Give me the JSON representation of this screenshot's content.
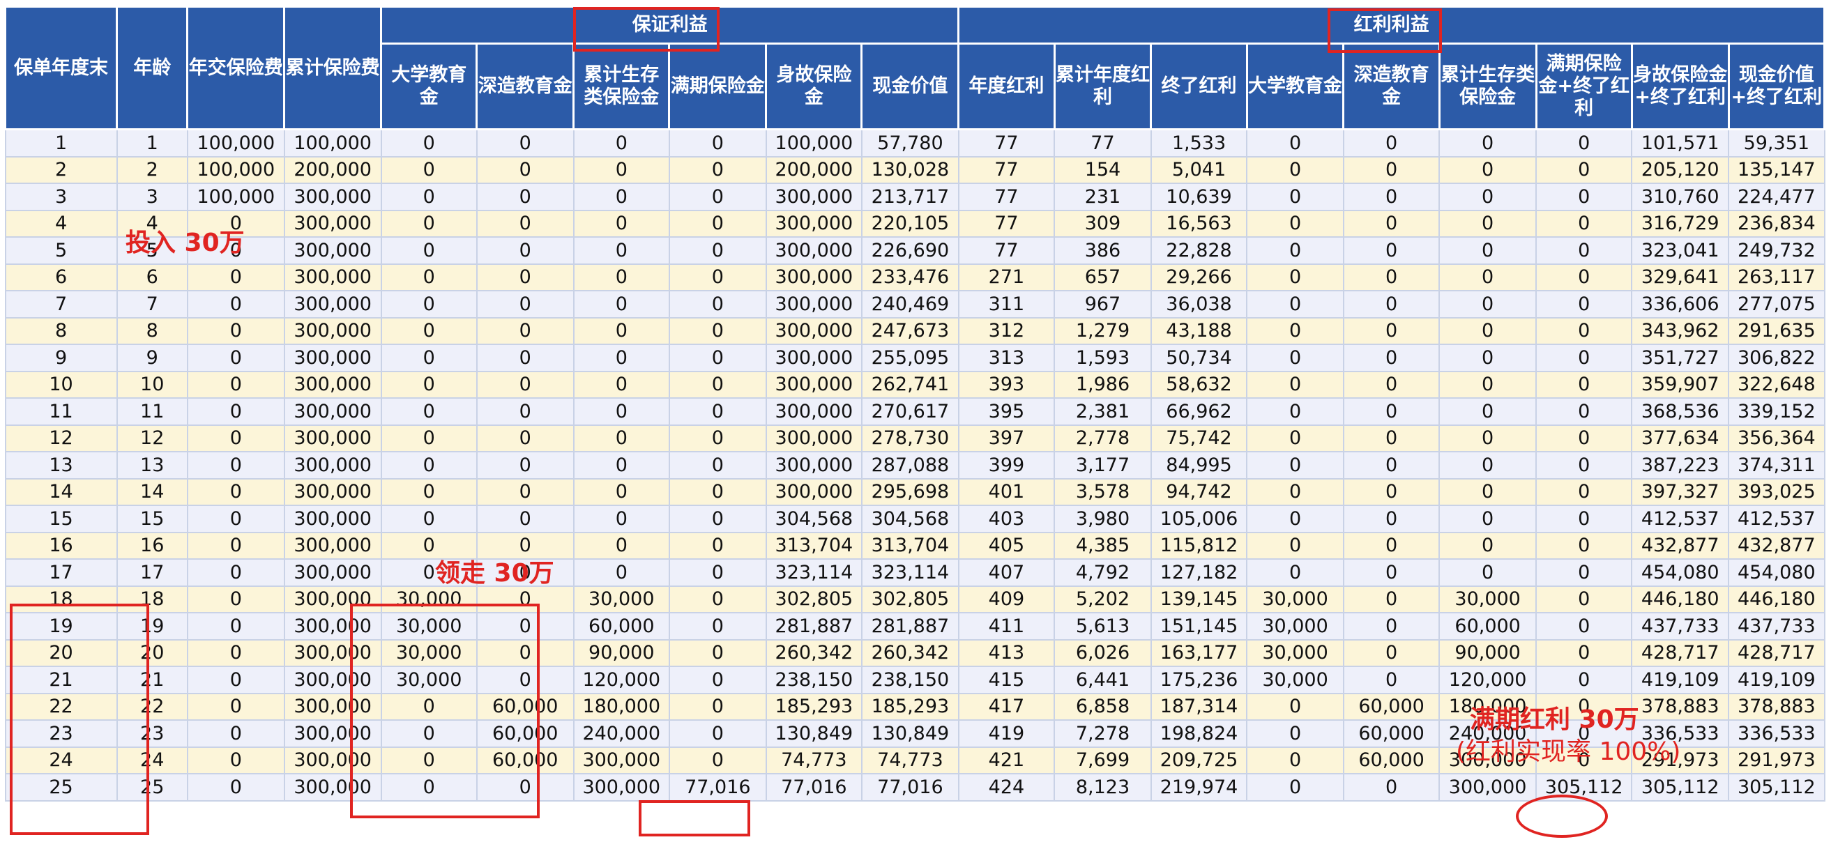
{
  "header": {
    "year_end": "保单年度末",
    "age": "年龄",
    "annual_premium": "年交保险费",
    "cumulative_premium": "累计保险费",
    "guaranteed_group": "保证利益",
    "dividend_group": "红利利益",
    "sub_columns": [
      "大学教育金",
      "深造教育金",
      "累计生存类保险金",
      "满期保险金",
      "身故保险金",
      "现金价值",
      "年度红利",
      "累计年度红利",
      "终了红利",
      "大学教育金",
      "深造教育金",
      "累计生存类保险金",
      "满期保险金+终了红利",
      "身故保险金+终了红利",
      "现金价值+终了红利"
    ]
  },
  "rows": [
    [
      "1",
      "1",
      "100,000",
      "100,000",
      "0",
      "0",
      "0",
      "0",
      "100,000",
      "57,780",
      "77",
      "77",
      "1,533",
      "0",
      "0",
      "0",
      "0",
      "101,571",
      "59,351"
    ],
    [
      "2",
      "2",
      "100,000",
      "200,000",
      "0",
      "0",
      "0",
      "0",
      "200,000",
      "130,028",
      "77",
      "154",
      "5,041",
      "0",
      "0",
      "0",
      "0",
      "205,120",
      "135,147"
    ],
    [
      "3",
      "3",
      "100,000",
      "300,000",
      "0",
      "0",
      "0",
      "0",
      "300,000",
      "213,717",
      "77",
      "231",
      "10,639",
      "0",
      "0",
      "0",
      "0",
      "310,760",
      "224,477"
    ],
    [
      "4",
      "4",
      "0",
      "300,000",
      "0",
      "0",
      "0",
      "0",
      "300,000",
      "220,105",
      "77",
      "309",
      "16,563",
      "0",
      "0",
      "0",
      "0",
      "316,729",
      "236,834"
    ],
    [
      "5",
      "5",
      "0",
      "300,000",
      "0",
      "0",
      "0",
      "0",
      "300,000",
      "226,690",
      "77",
      "386",
      "22,828",
      "0",
      "0",
      "0",
      "0",
      "323,041",
      "249,732"
    ],
    [
      "6",
      "6",
      "0",
      "300,000",
      "0",
      "0",
      "0",
      "0",
      "300,000",
      "233,476",
      "271",
      "657",
      "29,266",
      "0",
      "0",
      "0",
      "0",
      "329,641",
      "263,117"
    ],
    [
      "7",
      "7",
      "0",
      "300,000",
      "0",
      "0",
      "0",
      "0",
      "300,000",
      "240,469",
      "311",
      "967",
      "36,038",
      "0",
      "0",
      "0",
      "0",
      "336,606",
      "277,075"
    ],
    [
      "8",
      "8",
      "0",
      "300,000",
      "0",
      "0",
      "0",
      "0",
      "300,000",
      "247,673",
      "312",
      "1,279",
      "43,188",
      "0",
      "0",
      "0",
      "0",
      "343,962",
      "291,635"
    ],
    [
      "9",
      "9",
      "0",
      "300,000",
      "0",
      "0",
      "0",
      "0",
      "300,000",
      "255,095",
      "313",
      "1,593",
      "50,734",
      "0",
      "0",
      "0",
      "0",
      "351,727",
      "306,822"
    ],
    [
      "10",
      "10",
      "0",
      "300,000",
      "0",
      "0",
      "0",
      "0",
      "300,000",
      "262,741",
      "393",
      "1,986",
      "58,632",
      "0",
      "0",
      "0",
      "0",
      "359,907",
      "322,648"
    ],
    [
      "11",
      "11",
      "0",
      "300,000",
      "0",
      "0",
      "0",
      "0",
      "300,000",
      "270,617",
      "395",
      "2,381",
      "66,962",
      "0",
      "0",
      "0",
      "0",
      "368,536",
      "339,152"
    ],
    [
      "12",
      "12",
      "0",
      "300,000",
      "0",
      "0",
      "0",
      "0",
      "300,000",
      "278,730",
      "397",
      "2,778",
      "75,742",
      "0",
      "0",
      "0",
      "0",
      "377,634",
      "356,364"
    ],
    [
      "13",
      "13",
      "0",
      "300,000",
      "0",
      "0",
      "0",
      "0",
      "300,000",
      "287,088",
      "399",
      "3,177",
      "84,995",
      "0",
      "0",
      "0",
      "0",
      "387,223",
      "374,311"
    ],
    [
      "14",
      "14",
      "0",
      "300,000",
      "0",
      "0",
      "0",
      "0",
      "300,000",
      "295,698",
      "401",
      "3,578",
      "94,742",
      "0",
      "0",
      "0",
      "0",
      "397,327",
      "393,025"
    ],
    [
      "15",
      "15",
      "0",
      "300,000",
      "0",
      "0",
      "0",
      "0",
      "304,568",
      "304,568",
      "403",
      "3,980",
      "105,006",
      "0",
      "0",
      "0",
      "0",
      "412,537",
      "412,537"
    ],
    [
      "16",
      "16",
      "0",
      "300,000",
      "0",
      "0",
      "0",
      "0",
      "313,704",
      "313,704",
      "405",
      "4,385",
      "115,812",
      "0",
      "0",
      "0",
      "0",
      "432,877",
      "432,877"
    ],
    [
      "17",
      "17",
      "0",
      "300,000",
      "0",
      "0",
      "0",
      "0",
      "323,114",
      "323,114",
      "407",
      "4,792",
      "127,182",
      "0",
      "0",
      "0",
      "0",
      "454,080",
      "454,080"
    ],
    [
      "18",
      "18",
      "0",
      "300,000",
      "30,000",
      "0",
      "30,000",
      "0",
      "302,805",
      "302,805",
      "409",
      "5,202",
      "139,145",
      "30,000",
      "0",
      "30,000",
      "0",
      "446,180",
      "446,180"
    ],
    [
      "19",
      "19",
      "0",
      "300,000",
      "30,000",
      "0",
      "60,000",
      "0",
      "281,887",
      "281,887",
      "411",
      "5,613",
      "151,145",
      "30,000",
      "0",
      "60,000",
      "0",
      "437,733",
      "437,733"
    ],
    [
      "20",
      "20",
      "0",
      "300,000",
      "30,000",
      "0",
      "90,000",
      "0",
      "260,342",
      "260,342",
      "413",
      "6,026",
      "163,177",
      "30,000",
      "0",
      "90,000",
      "0",
      "428,717",
      "428,717"
    ],
    [
      "21",
      "21",
      "0",
      "300,000",
      "30,000",
      "0",
      "120,000",
      "0",
      "238,150",
      "238,150",
      "415",
      "6,441",
      "175,236",
      "30,000",
      "0",
      "120,000",
      "0",
      "419,109",
      "419,109"
    ],
    [
      "22",
      "22",
      "0",
      "300,000",
      "0",
      "60,000",
      "180,000",
      "0",
      "185,293",
      "185,293",
      "417",
      "6,858",
      "187,314",
      "0",
      "60,000",
      "180,000",
      "0",
      "378,883",
      "378,883"
    ],
    [
      "23",
      "23",
      "0",
      "300,000",
      "0",
      "60,000",
      "240,000",
      "0",
      "130,849",
      "130,849",
      "419",
      "7,278",
      "198,824",
      "0",
      "60,000",
      "240,000",
      "0",
      "336,533",
      "336,533"
    ],
    [
      "24",
      "24",
      "0",
      "300,000",
      "0",
      "60,000",
      "300,000",
      "0",
      "74,773",
      "74,773",
      "421",
      "7,699",
      "209,725",
      "0",
      "60,000",
      "300,000",
      "0",
      "291,973",
      "291,973"
    ],
    [
      "25",
      "25",
      "0",
      "300,000",
      "0",
      "0",
      "300,000",
      "77,016",
      "77,016",
      "77,016",
      "424",
      "8,123",
      "219,974",
      "0",
      "0",
      "300,000",
      "305,112",
      "305,112",
      "305,112"
    ]
  ],
  "annotations": {
    "invest": "投入 30万",
    "withdraw": "领走 30万",
    "maturity_line1": "满期红利 30万",
    "maturity_line2": "(红利实现率 100%)"
  },
  "colors": {
    "header_bg": "#2c5ba8",
    "row_odd": "#eef0fa",
    "row_even": "#fcf5d9",
    "annotation": "#e02421"
  }
}
